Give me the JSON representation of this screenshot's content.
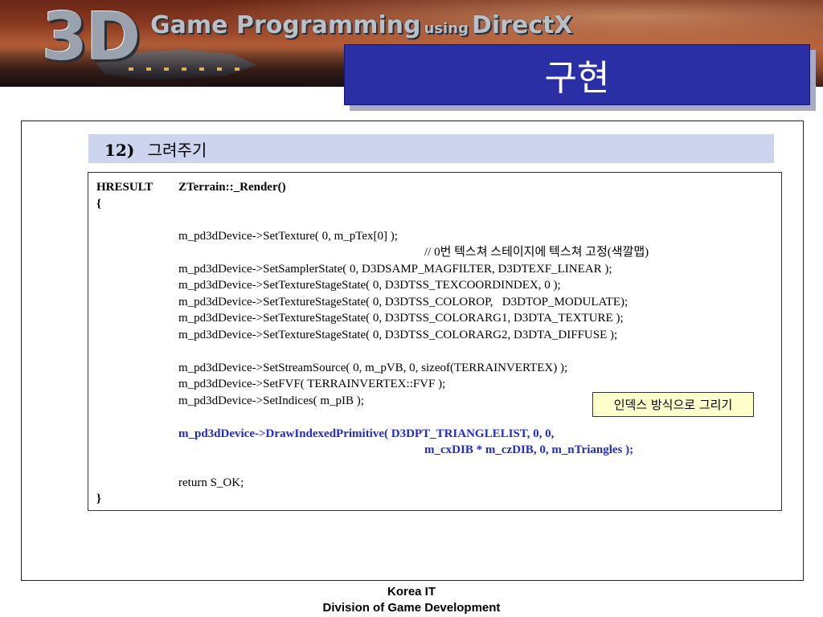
{
  "header": {
    "logo_3d": "3D",
    "logo_game": "Game Programming",
    "logo_using": "using",
    "logo_directx": "DirectX",
    "slide_title": "구현"
  },
  "section": {
    "number": "12)",
    "title": "그려주기"
  },
  "code": {
    "sig_type": "HRESULT",
    "sig_name": "ZTerrain::_Render()",
    "open_brace": "{",
    "line_settexture": "m_pd3dDevice->SetTexture( 0, m_pTex[0] );",
    "comment_stage": "// 0번 텍스쳐 스테이지에 텍스쳐 고정(색깔맵)",
    "line_sampler": "m_pd3dDevice->SetSamplerState( 0, D3DSAMP_MAGFILTER, D3DTEXF_LINEAR );",
    "line_tss1": "m_pd3dDevice->SetTextureStageState( 0, D3DTSS_TEXCOORDINDEX, 0 );",
    "line_tss2": "m_pd3dDevice->SetTextureStageState( 0, D3DTSS_COLOROP,   D3DTOP_MODULATE);",
    "line_tss3": "m_pd3dDevice->SetTextureStageState( 0, D3DTSS_COLORARG1, D3DTA_TEXTURE );",
    "line_tss4": "m_pd3dDevice->SetTextureStageState( 0, D3DTSS_COLORARG2, D3DTA_DIFFUSE );",
    "line_stream": "m_pd3dDevice->SetStreamSource( 0, m_pVB, 0, sizeof(TERRAINVERTEX) );",
    "line_fvf": "m_pd3dDevice->SetFVF( TERRAINVERTEX::FVF );",
    "line_indices": "m_pd3dDevice->SetIndices( m_pIB );",
    "line_draw1": "m_pd3dDevice->DrawIndexedPrimitive( D3DPT_TRIANGLELIST, 0, 0,",
    "line_draw2": "m_cxDIB * m_czDIB, 0, m_nTriangles );",
    "line_return": "return S_OK;",
    "close_brace": "}"
  },
  "note": "인덱스 방식으로 그리기",
  "footer": {
    "line1": "Korea IT",
    "line2": "Division of Game Development"
  },
  "colors": {
    "title_box_bg": "#2b2fa6",
    "subhead_bg": "#ccd4ee",
    "highlight_code": "#1f2ad6",
    "note_bg": "#ffffcc"
  }
}
